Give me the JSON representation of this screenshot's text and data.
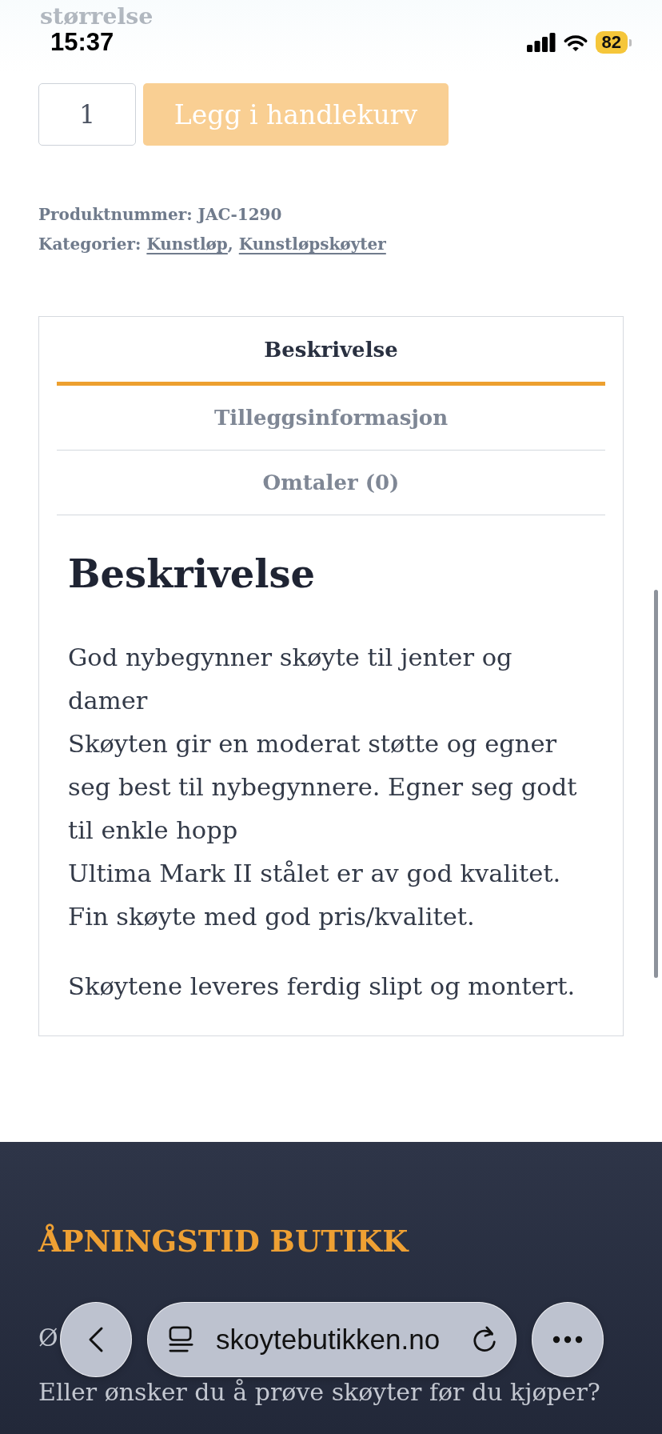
{
  "status_bar": {
    "time": "15:37",
    "battery": "82"
  },
  "variation_label": "størrelse",
  "add_to_cart": {
    "quantity": "1",
    "button": "Legg i handlekurv",
    "disabled": true
  },
  "product_meta": {
    "sku_line": "Produktnummer: JAC-1290",
    "categories_label": "Kategorier:",
    "separator": ",",
    "categories": [
      "Kunstløp",
      "Kunstløpskøyter"
    ]
  },
  "tabs": [
    {
      "label": "Beskrivelse",
      "selected": true
    },
    {
      "label": "Tilleggsinformasjon",
      "selected": false
    },
    {
      "label": "Omtaler (0)",
      "selected": false
    }
  ],
  "description": {
    "heading": "Beskrivelse",
    "paragraphs": [
      "God nybegynner skøyte til jenter og damer\nSkøyten gir en moderat støtte og egner seg best til nybegynnere. Egner seg godt til enkle hopp\nUltima Mark II stålet er av god kvalitet.\nFin skøyte med god pris/kvalitet.",
      "Skøytene leveres ferdig slipt og montert."
    ]
  },
  "footer": {
    "heading": "ÅPNINGSTID BUTIKK",
    "lines": [
      "Ø",
      "Eller ønsker du å prøve skøyter før du kjøper?"
    ]
  },
  "browser_toolbar": {
    "url": "skoytebutikken.no"
  }
}
